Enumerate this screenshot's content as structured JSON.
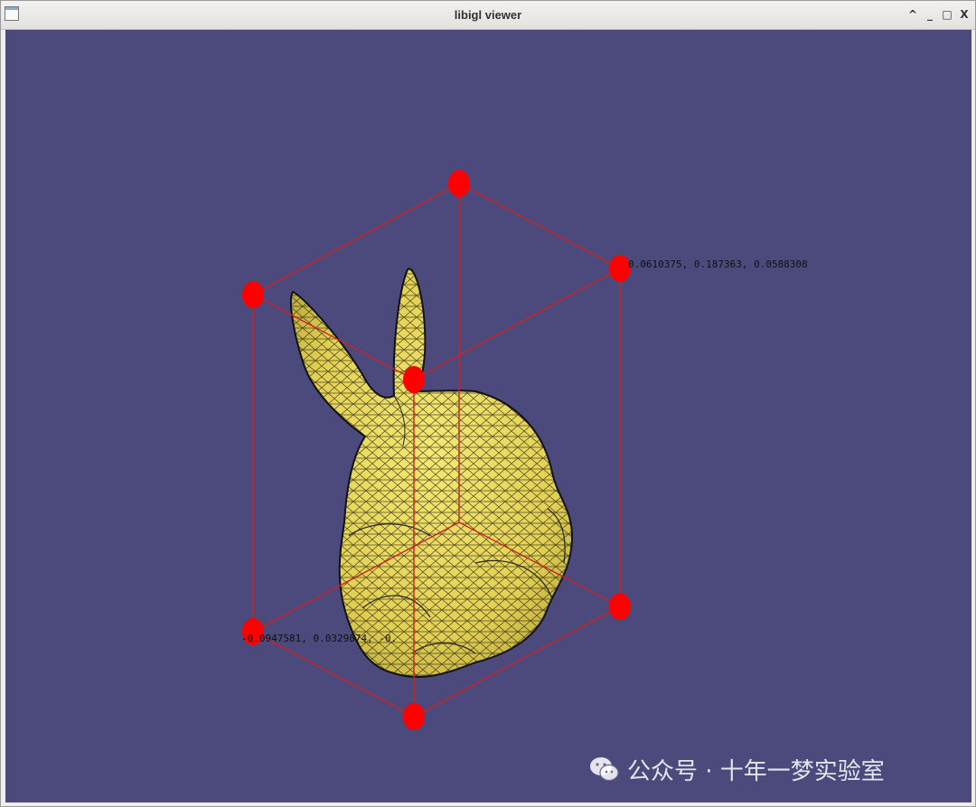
{
  "window": {
    "title": "libigl viewer",
    "controls": {
      "minimize_up": "^",
      "minimize": "_",
      "maximize": "□",
      "close": "X"
    }
  },
  "viewport": {
    "background_color": "#4c4a7d",
    "mesh": {
      "name": "bunny",
      "fill_color": "#e8d95a",
      "wire_color": "#1b1b12"
    },
    "bounding_box": {
      "edge_color": "#cc2222",
      "vertex_color": "#ff0000"
    },
    "labels": {
      "max_corner": "0.0610375, 0.187363, 0.0588308",
      "min_corner": "-0.0947581, 0.0329874, -0."
    }
  },
  "watermark": {
    "text": "公众号 · 十年一梦实验室",
    "icon": "wechat-icon"
  }
}
